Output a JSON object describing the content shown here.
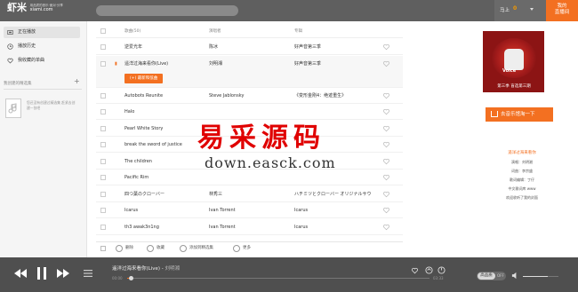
{
  "header": {
    "logo_text": "虾米",
    "logo_slogan": "用品质的音乐·面对·分享",
    "logo_domain": "xiami.com",
    "login_text": "马上",
    "counter": "0",
    "my_station_line1": "我的",
    "my_station_line2": "直播间"
  },
  "sidebar": {
    "items": [
      {
        "label": "正在播放",
        "icon": "now-playing-icon"
      },
      {
        "label": "播放历史",
        "icon": "history-icon"
      },
      {
        "label": "我收藏的单曲",
        "icon": "heart-icon"
      }
    ],
    "playlists_heading": "我创建的精选集",
    "empty_text": "您还没有创建过精选集 赶紧去创建一张吧"
  },
  "table": {
    "headers": {
      "song": "歌曲(50)",
      "artist": "演唱者",
      "album": "专辑"
    },
    "rows": [
      {
        "song": "逆爱光年",
        "artist": "陈冰",
        "album": "好声音第三季"
      },
      {
        "song": "遥洋过海来看你(Live)",
        "artist": "刘明湘",
        "album": "好声音第三季",
        "playing": true
      },
      {
        "song": "Autobots Reunite",
        "artist": "Steve Jablonsky",
        "album": "《变形金刚4：绝迹重生》"
      },
      {
        "song": "Halo",
        "artist": "",
        "album": ""
      },
      {
        "song": "Pearl White Story",
        "artist": "",
        "album": ""
      },
      {
        "song": "break the sword of justice",
        "artist": "",
        "album": ""
      },
      {
        "song": "The children",
        "artist": "",
        "album": ""
      },
      {
        "song": "Pacific Rim",
        "artist": "",
        "album": ""
      },
      {
        "song": "四つ葉のクローバー",
        "artist": "林秀三",
        "album": "ハチミツとクローバー オリジナルサウ"
      },
      {
        "song": "Icarus",
        "artist": "Ivan Torrent",
        "album": "Icarus"
      },
      {
        "song": "th3 awak3n1ng",
        "artist": "Ivan Torrent",
        "album": "Icarus"
      }
    ],
    "play_button_label": "最新和弦曲"
  },
  "actions": {
    "delete": "删除",
    "favorite": "收藏",
    "add_to_collection": "添加到精选集",
    "more": "更多"
  },
  "watermark": {
    "cn": "易采源码",
    "url": "down.easck.com"
  },
  "album_panel": {
    "cover_title": "Voice",
    "cover_subtitle": "第三季 盲选第三期",
    "buy_button": "去音乐馆淘一下",
    "lyric_title": "遥洋过海来看你",
    "lyric_lines": [
      "演唱：刘明湘",
      "词曲：李宗盛",
      "歌词编辑：丁仔",
      "中文歌词库 www",
      "欢迎收听了我的封面"
    ]
  },
  "player": {
    "song": "遥洋过海来看你(Live)",
    "artist": "刘明湘",
    "current_time": "00:00",
    "total_time": "03:33",
    "quality_on": "高品质",
    "quality_off": "OFF",
    "progress": 0.01,
    "volume": 0.7
  }
}
